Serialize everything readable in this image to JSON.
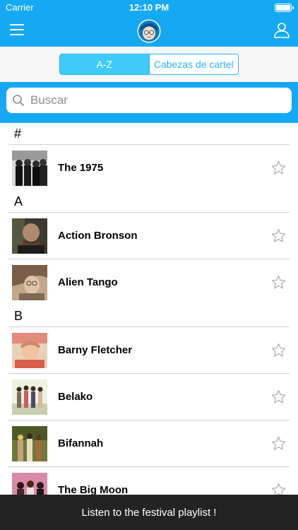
{
  "status": {
    "carrier": "Carrier",
    "time": "12:10 PM"
  },
  "header": {
    "menu_icon": "hamburger-menu-icon",
    "logo_icon": "mascot-logo-icon",
    "user_icon": "user-profile-icon"
  },
  "segments": {
    "az": "A-Z",
    "headliners": "Cabezas de cartel",
    "active": "az"
  },
  "search": {
    "placeholder": "Buscar"
  },
  "sections": [
    {
      "header": "#",
      "items": [
        {
          "name": "The 1975"
        }
      ]
    },
    {
      "header": "A",
      "items": [
        {
          "name": "Action Bronson"
        },
        {
          "name": "Alien Tango"
        }
      ]
    },
    {
      "header": "B",
      "items": [
        {
          "name": "Barny Fletcher"
        },
        {
          "name": "Belako"
        },
        {
          "name": "Bifannah"
        },
        {
          "name": "The Big Moon"
        }
      ]
    }
  ],
  "bottom_bar": {
    "label": "Listen to the festival playlist !"
  },
  "colors": {
    "accent": "#16a9f3",
    "segment_active": "#3ecbf8",
    "bottom_bar": "#232323",
    "star": "#a0a0a0"
  }
}
